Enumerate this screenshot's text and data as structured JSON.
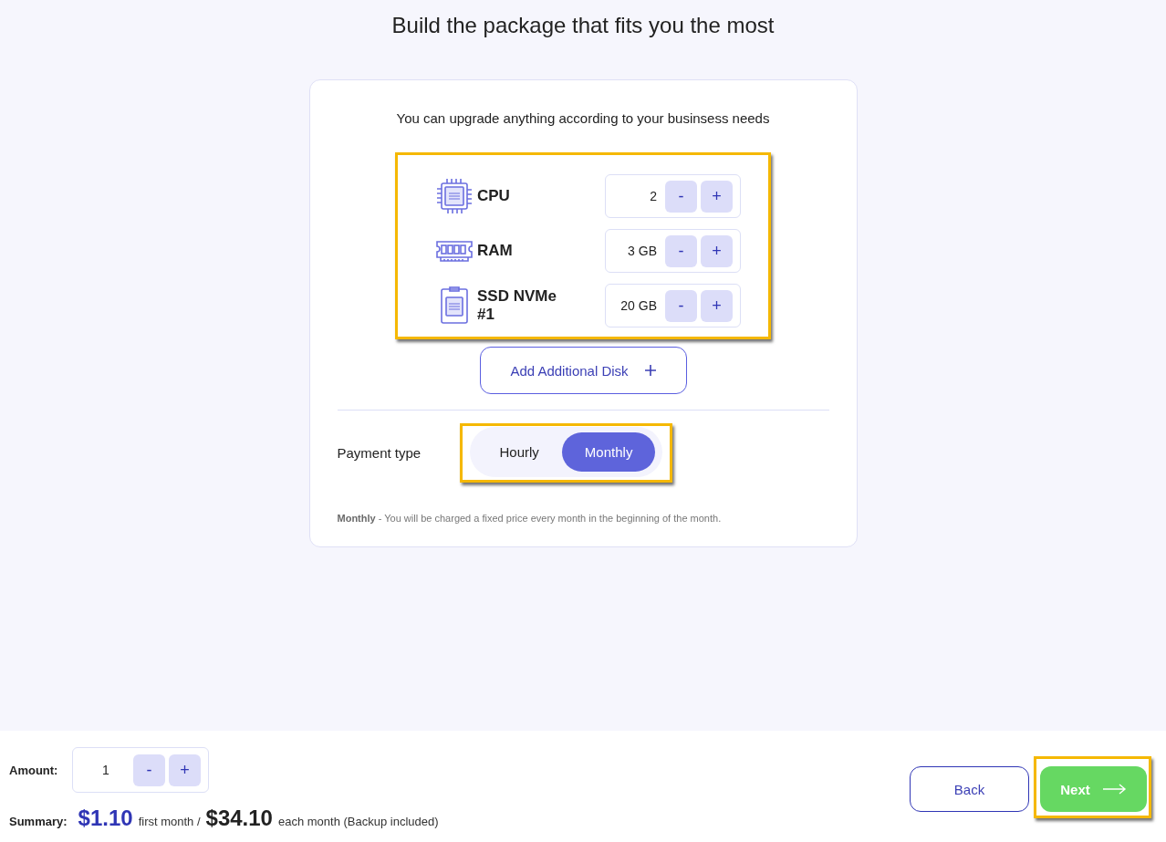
{
  "title": "Build the package that fits you the most",
  "card": {
    "subtitle": "You can upgrade anything according to your businsess needs",
    "resources": {
      "highlighted": true,
      "items": [
        {
          "kind": "cpu",
          "label": "CPU",
          "value": "2",
          "decrement": "-",
          "increment": "+"
        },
        {
          "kind": "ram",
          "label": "RAM",
          "value": "3 GB",
          "decrement": "-",
          "increment": "+"
        },
        {
          "kind": "disk",
          "label": "SSD NVMe #1",
          "value": "20 GB",
          "decrement": "-",
          "increment": "+"
        }
      ]
    },
    "add_disk_button": "Add Additional Disk",
    "payment": {
      "label": "Payment type",
      "highlighted": true,
      "options": [
        {
          "label": "Hourly",
          "selected": false
        },
        {
          "label": "Monthly",
          "selected": true
        }
      ]
    },
    "note": "**Monthly** - You will be charged a fixed price every month in the beginning of the month."
  },
  "footer": {
    "amount": {
      "label": "Amount:",
      "value": "1",
      "decrement": "-",
      "increment": "+"
    },
    "summary": {
      "label": "Summary:",
      "first_price": "$1.10",
      "first_note": "first month /",
      "monthly_price": "$34.10",
      "monthly_note": "each month (Backup included)"
    },
    "back_button": "Back",
    "next_button": {
      "label": "Next",
      "highlighted": true
    }
  }
}
